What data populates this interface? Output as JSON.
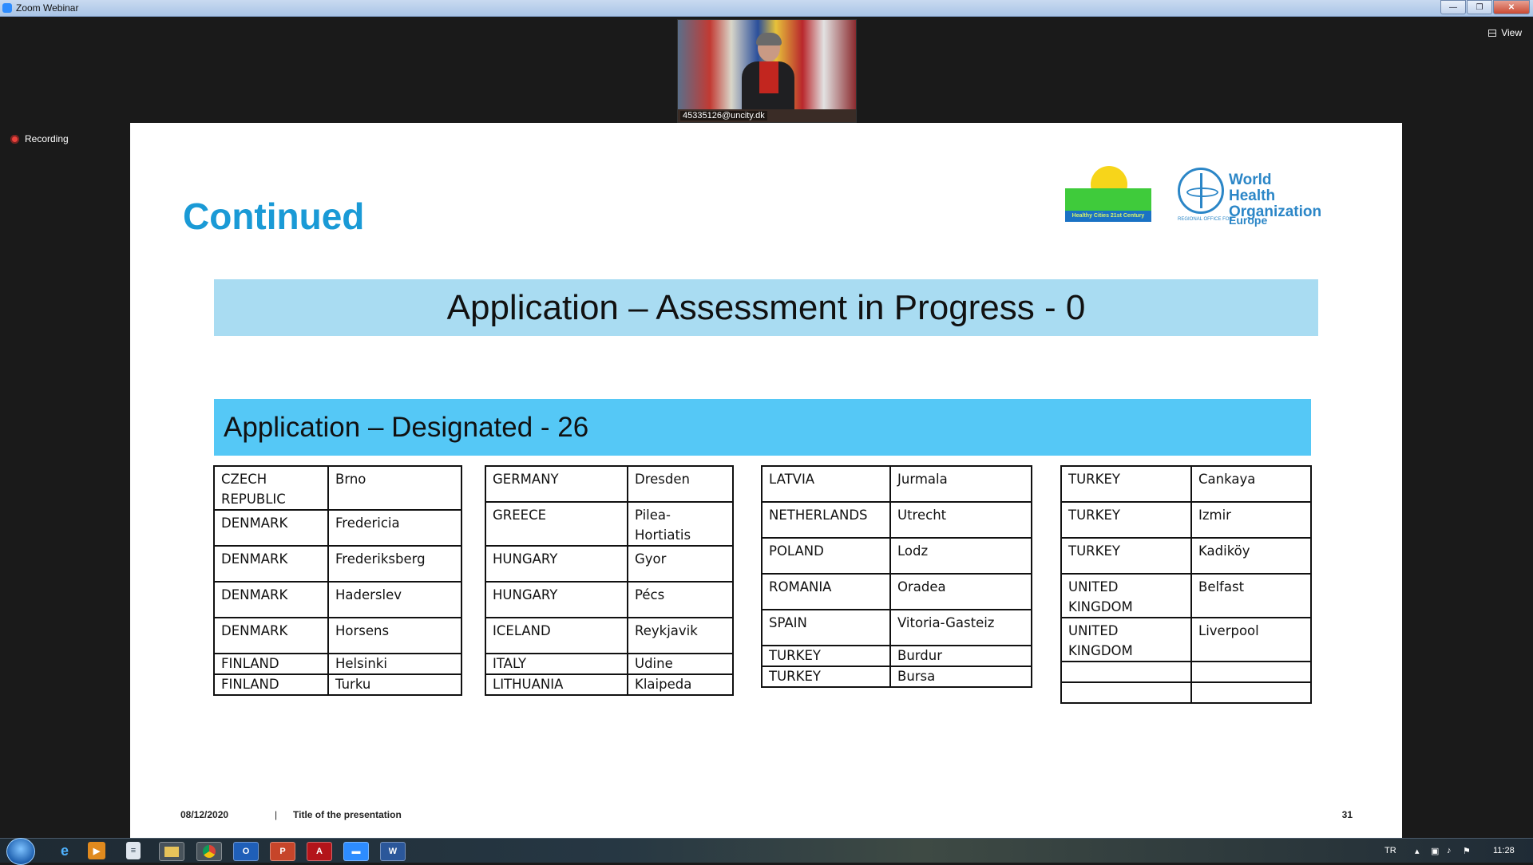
{
  "window": {
    "title": "Zoom Webinar"
  },
  "zoom": {
    "view_label": "View",
    "recording_label": "Recording",
    "participant_name": "45335126@uncity.dk"
  },
  "slide": {
    "title": "Continued",
    "logos": {
      "who_line1": "World Health",
      "who_line2": "Organization",
      "who_region": "Europe",
      "who_small": "REGIONAL OFFICE FOR",
      "healthy_cities_band": "Healthy Cities 21st Century"
    },
    "banner_progress": "Application – Assessment in Progress - 0",
    "banner_designated": "Application – Designated - 26",
    "tables": [
      [
        [
          "CZECH REPUBLIC",
          "Brno"
        ],
        [
          "DENMARK",
          "Fredericia"
        ],
        [
          "DENMARK",
          "Frederiksberg"
        ],
        [
          "DENMARK",
          "Haderslev"
        ],
        [
          "DENMARK",
          "Horsens"
        ],
        [
          "FINLAND",
          "Helsinki"
        ],
        [
          "FINLAND",
          "Turku"
        ]
      ],
      [
        [
          "GERMANY",
          "Dresden"
        ],
        [
          "GREECE",
          "Pilea-Hortiatis"
        ],
        [
          "HUNGARY",
          "Gyor"
        ],
        [
          "HUNGARY",
          "Pécs"
        ],
        [
          "ICELAND",
          "Reykjavik"
        ],
        [
          "ITALY",
          "Udine"
        ],
        [
          "LITHUANIA",
          "Klaipeda"
        ]
      ],
      [
        [
          "LATVIA",
          "Jurmala"
        ],
        [
          "NETHERLANDS",
          "Utrecht"
        ],
        [
          "POLAND",
          "Lodz"
        ],
        [
          "ROMANIA",
          "Oradea"
        ],
        [
          "SPAIN",
          "Vitoria-Gasteiz"
        ],
        [
          "TURKEY",
          "Burdur"
        ],
        [
          "TURKEY",
          "Bursa"
        ]
      ],
      [
        [
          "TURKEY",
          "Cankaya"
        ],
        [
          "TURKEY",
          "Izmir"
        ],
        [
          "TURKEY",
          "Kadiköy"
        ],
        [
          "UNITED KINGDOM",
          "Belfast"
        ],
        [
          "UNITED KINGDOM",
          "Liverpool"
        ],
        [
          "",
          ""
        ],
        [
          "",
          ""
        ]
      ]
    ],
    "footer": {
      "date": "08/12/2020",
      "separator": "|",
      "presentation_title": "Title of the presentation",
      "page_number": "31"
    }
  },
  "taskbar": {
    "icons": [
      "start-orb",
      "internet-explorer-icon",
      "media-player-icon",
      "documents-icon",
      "file-explorer-icon",
      "chrome-icon",
      "outlook-icon",
      "powerpoint-icon",
      "acrobat-icon",
      "zoom-icon",
      "word-icon"
    ],
    "language": "TR",
    "clock": "11:28"
  }
}
